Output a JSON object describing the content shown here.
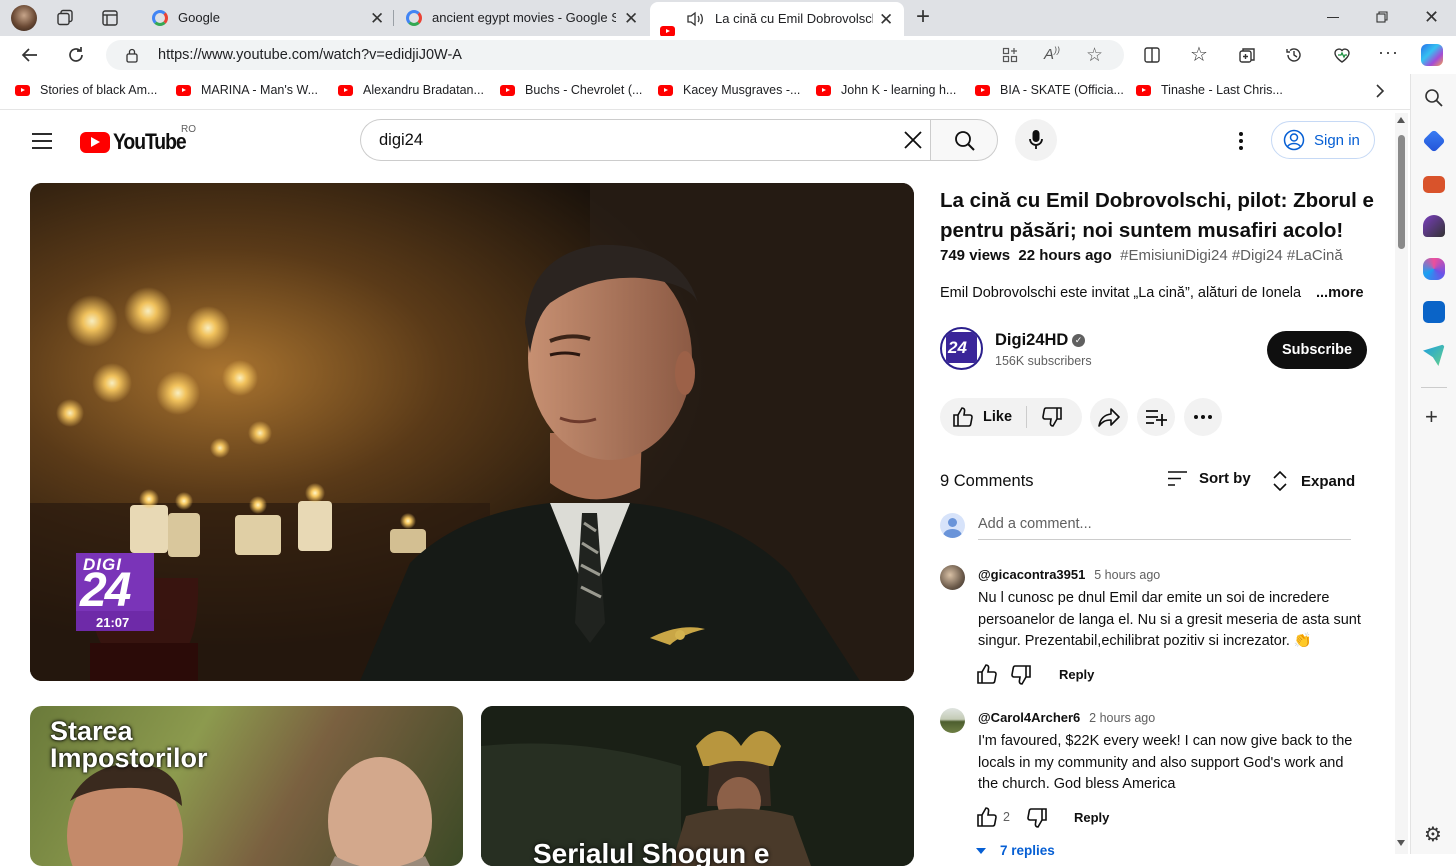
{
  "browser": {
    "tabs": [
      {
        "label": "Google"
      },
      {
        "label": "ancient egypt movies - Google Se"
      },
      {
        "label": "La cină cu Emil Dobrovolsch"
      }
    ],
    "url": "https://www.youtube.com/watch?v=edidjiJ0W-A",
    "bookmarks": [
      "Stories of black Am...",
      "MARINA - Man's W...",
      "Alexandru Bradatan...",
      "Buchs - Chevrolet (...",
      "Kacey Musgraves -...",
      "John K - learning h...",
      "BIA - SKATE (Officia...",
      "Tinashe - Last Chris..."
    ]
  },
  "youtube": {
    "logo_text": "YouTube",
    "region": "RO",
    "search_value": "digi24",
    "signin_label": "Sign in"
  },
  "player": {
    "channel_logo_line1": "DIGI",
    "channel_logo_line2": "24",
    "clock": "21:07"
  },
  "video": {
    "title": "La cină cu Emil Dobrovolschi, pilot: Zborul e pentru păsări; noi suntem musafiri acolo!",
    "views": "749 views",
    "age": "22 hours ago",
    "hashtags": "#EmisiuniDigi24 #Digi24 #LaCină",
    "description": "Emil Dobrovolschi este invitat „La cină”, alături de Ionela",
    "more_label": "...more",
    "channel_name": "Digi24HD",
    "subscribers": "156K subscribers",
    "subscribe_label": "Subscribe",
    "like_label": "Like"
  },
  "comments": {
    "count_label": "9 Comments",
    "sort_label": "Sort by",
    "expand_label": "Expand",
    "add_placeholder": "Add a comment...",
    "items": [
      {
        "author": "@gicacontra3951",
        "time": "5 hours ago",
        "text": "Nu l cunosc pe dnul Emil dar emite un soi de incredere persoanelor de langa el. Nu si a gresit meseria de asta sunt singur. Prezentabil,echilibrat pozitiv si increzator. 👏",
        "likes": "",
        "reply_label": "Reply"
      },
      {
        "author": "@Carol4Archer6",
        "time": "2 hours ago",
        "text": "I'm favoured, $22K every week! I can now give back to the locals in my community and also support God's work and the church. God bless America",
        "likes": "2",
        "reply_label": "Reply",
        "replies_label": "7 replies"
      }
    ]
  },
  "related": [
    {
      "title_line1": "Starea",
      "title_line2": "Impostorilor"
    },
    {
      "title_partial": "Serialul Shogun e"
    }
  ]
}
